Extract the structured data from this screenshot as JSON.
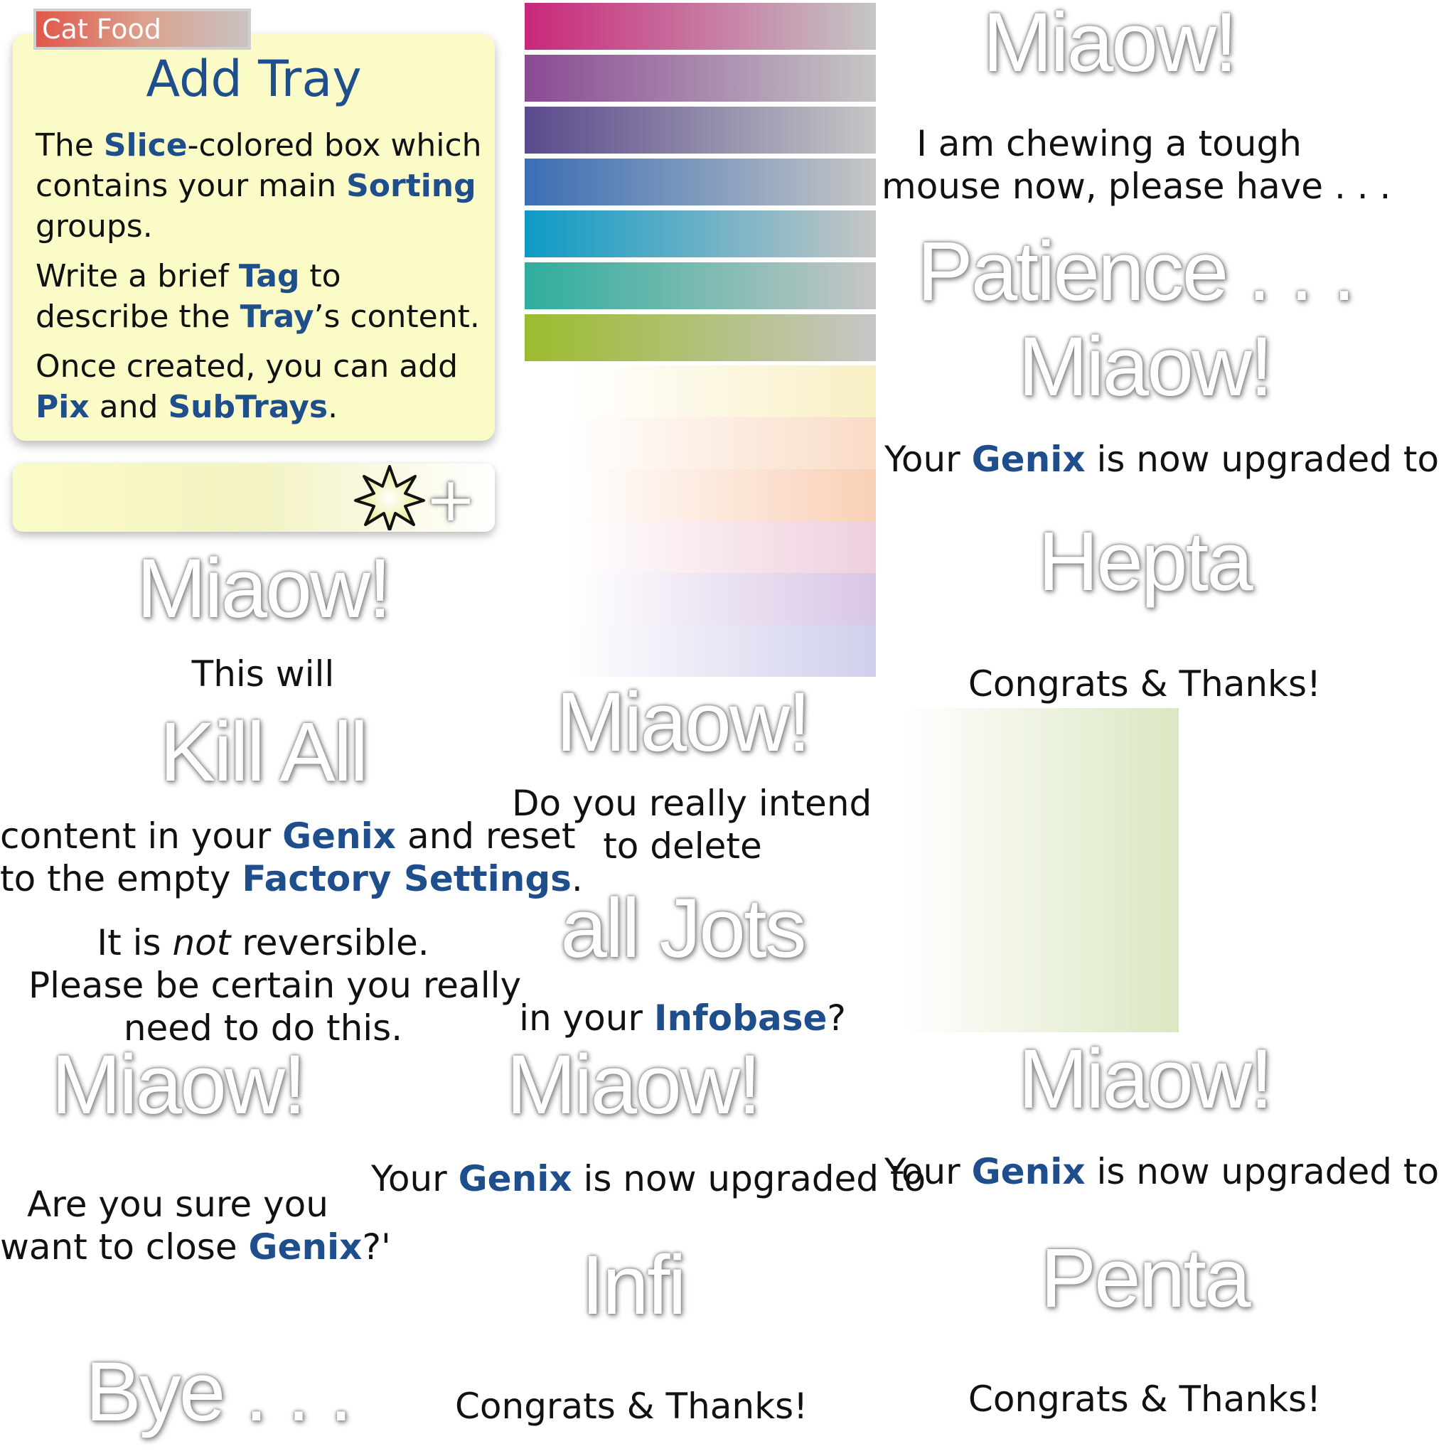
{
  "tooltip": {
    "category": "Cat Food",
    "title": "Add Tray",
    "p1_a": "The ",
    "p1_b": "Slice",
    "p1_c": "-colored box which contains your main ",
    "p1_d": "Sorting",
    "p1_e": " groups.",
    "p2_a": "Write a brief ",
    "p2_b": "Tag",
    "p2_c": " to describe the ",
    "p2_d": "Tray",
    "p2_e": "’s content.",
    "p3_a": "Once created, you can add ",
    "p3_b": "Pix",
    "p3_c": " and ",
    "p3_d": "SubTrays",
    "p3_e": "."
  },
  "add_bar": {
    "star_icon": "sparkle-star-icon",
    "plus_icon": "plus-icon",
    "plus_glyph": "+"
  },
  "swatches": {
    "strong": [
      "#c8287a",
      "#8a4a94",
      "#5a4a8c",
      "#3a6eb4",
      "#0e9ac6",
      "#2eae9c",
      "#9cbc2e"
    ],
    "pastel": [
      "#f9efc4",
      "#f9dbc6",
      "#f9d0b6",
      "#efcfde",
      "#d8c6e6",
      "#cfcfec"
    ]
  },
  "dialogs": {
    "patience": {
      "miaow": "Miaow!",
      "line1": "I am chewing a tough",
      "line2": "mouse now, please have . . .",
      "big": "Patience . . ."
    },
    "hepta": {
      "miaow": "Miaow!",
      "t_a": "Your ",
      "t_b": "Genix",
      "t_c": " is now upgraded to",
      "big": "Hepta",
      "thanks": "Congrats & Thanks!"
    },
    "kill": {
      "miaow": "Miaow!",
      "pre": "This will",
      "big": "Kill All",
      "l1_a": "content in your ",
      "l1_b": "Genix",
      "l1_c": " and reset",
      "l2_a": "to the empty ",
      "l2_b": "Factory Settings",
      "l2_c": ".",
      "l3_a": "It is ",
      "l3_b": "not",
      "l3_c": " reversible.",
      "l4": "Please be certain you really",
      "l5": "need to do this."
    },
    "jots": {
      "miaow": "Miaow!",
      "l1": "Do you really intend",
      "l2": "to delete",
      "big": "all Jots",
      "l3_a": "in your ",
      "l3_b": "Infobase",
      "l3_c": "?"
    },
    "bye": {
      "miaow": "Miaow!",
      "l1": "Are you sure you",
      "l2_a": "want to close ",
      "l2_b": "Genix",
      "l2_c": "?'",
      "big": "Bye . . ."
    },
    "infi": {
      "miaow": "Miaow!",
      "t_a": "Your ",
      "t_b": "Genix",
      "t_c": " is now upgraded to",
      "big": "Infi",
      "thanks": "Congrats & Thanks!"
    },
    "penta": {
      "miaow": "Miaow!",
      "t_a": "Your ",
      "t_b": "Genix",
      "t_c": " is now upgraded to",
      "big": "Penta",
      "thanks": "Congrats & Thanks!"
    }
  },
  "colors": {
    "accent": "#1f4e8c",
    "card_bg": "#fbfbc8",
    "tag_red": "#e0574a"
  }
}
